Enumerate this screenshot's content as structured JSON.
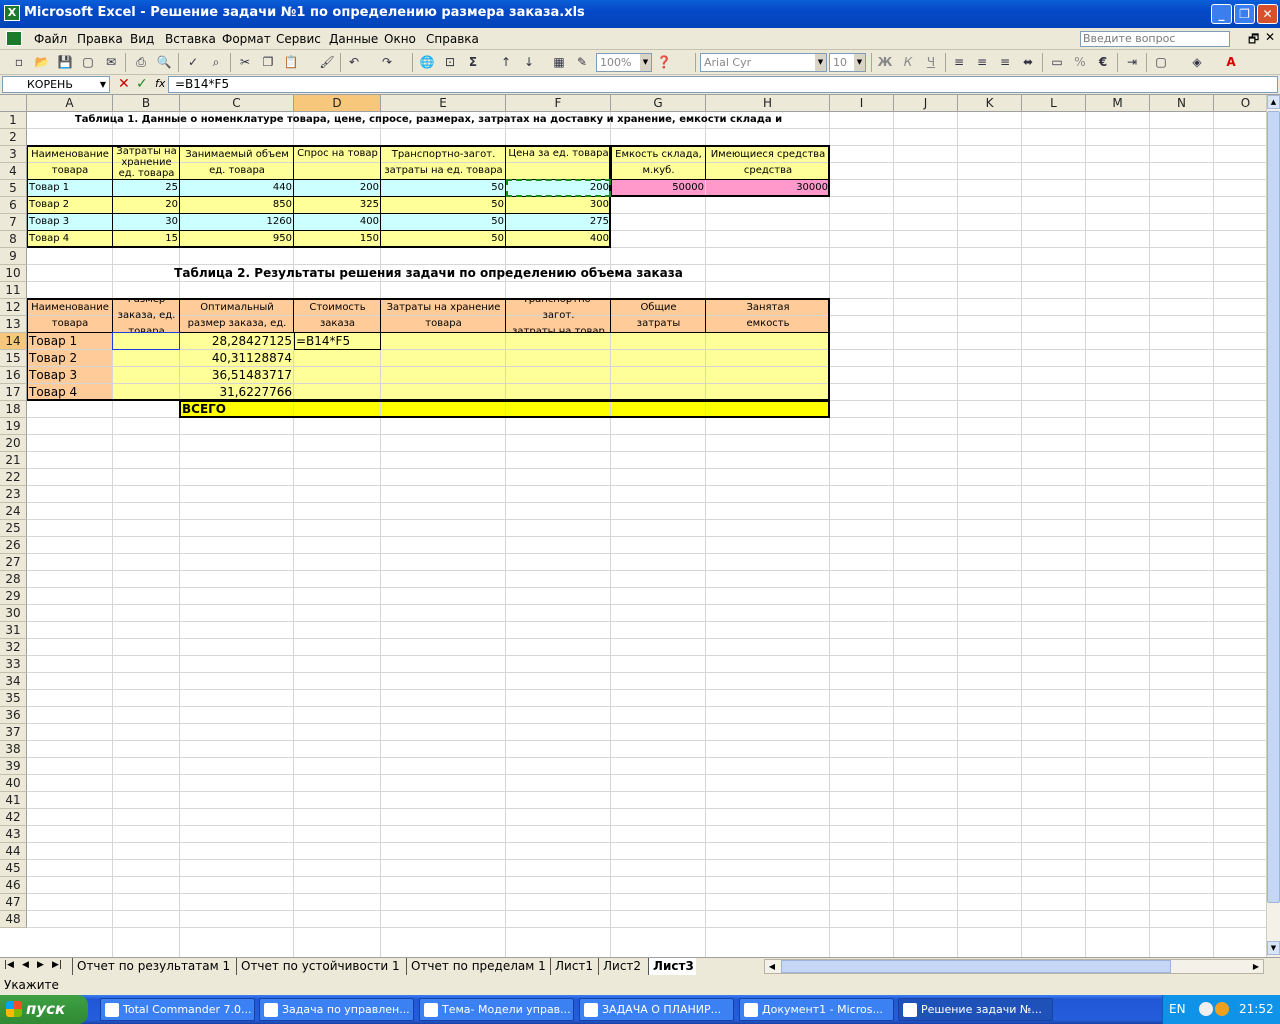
{
  "window": {
    "app_icon": "X",
    "title": "Microsoft Excel - Решение задачи №1 по определению размера заказа.xls"
  },
  "menu": {
    "items": [
      "Файл",
      "Правка",
      "Вид",
      "Вставка",
      "Формат",
      "Сервис",
      "Данные",
      "Окно",
      "Справка"
    ],
    "ask_placeholder": "Введите вопрос"
  },
  "toolbar": {
    "zoom": "100%",
    "font": "Arial Cyr",
    "size": "10",
    "bold": "Ж",
    "italic": "К",
    "underline": "Ч",
    "percent": "%",
    "euro": "€",
    "sigma": "Σ"
  },
  "formula": {
    "name_box": "КОРЕНЬ",
    "fx": "fx",
    "value": "=B14*F5"
  },
  "columns": [
    "A",
    "B",
    "C",
    "D",
    "E",
    "F",
    "G",
    "H",
    "I",
    "J",
    "K",
    "L",
    "M",
    "N",
    "O"
  ],
  "rows_visible": 48,
  "cells": [
    {
      "r": 1,
      "c": "A",
      "span": 8,
      "v": "Таблица 1. Данные о номенклатуре товара, цене, спросе, размерах, затратах на доставку и хранение, емкости склада и",
      "bold": true,
      "align": "center"
    },
    {
      "r": 3,
      "c": "A",
      "rs": 2,
      "v": "Наименование\nтовара",
      "align": "center"
    },
    {
      "r": 3,
      "c": "B",
      "rs": 2,
      "v": "Затраты на\nхранение\nед. товара",
      "align": "center"
    },
    {
      "r": 3,
      "c": "C",
      "rs": 2,
      "v": "Занимаемый объем\nед. товара",
      "align": "center"
    },
    {
      "r": 3,
      "c": "D",
      "rs": 2,
      "v": "Спрос на товар",
      "align": "center"
    },
    {
      "r": 3,
      "c": "E",
      "rs": 2,
      "v": "Транспортно-загот.\nзатраты на ед. товара",
      "align": "center"
    },
    {
      "r": 3,
      "c": "F",
      "rs": 2,
      "v": "Цена за ед. товара",
      "align": "center"
    },
    {
      "r": 3,
      "c": "G",
      "rs": 2,
      "v": "Емкость склада,\nм.куб.",
      "align": "center"
    },
    {
      "r": 3,
      "c": "H",
      "rs": 2,
      "v": "Имеющиеся средства\nсредства",
      "align": "center"
    },
    {
      "r": 5,
      "c": "A",
      "v": "Товар 1"
    },
    {
      "r": 5,
      "c": "B",
      "v": "25",
      "align": "right"
    },
    {
      "r": 5,
      "c": "C",
      "v": "440",
      "align": "right"
    },
    {
      "r": 5,
      "c": "D",
      "v": "200",
      "align": "right"
    },
    {
      "r": 5,
      "c": "E",
      "v": "50",
      "align": "right"
    },
    {
      "r": 5,
      "c": "F",
      "v": "200",
      "align": "right"
    },
    {
      "r": 5,
      "c": "G",
      "v": "50000",
      "align": "right"
    },
    {
      "r": 5,
      "c": "H",
      "v": "30000",
      "align": "right"
    },
    {
      "r": 6,
      "c": "A",
      "v": "Товар 2"
    },
    {
      "r": 6,
      "c": "B",
      "v": "20",
      "align": "right"
    },
    {
      "r": 6,
      "c": "C",
      "v": "850",
      "align": "right"
    },
    {
      "r": 6,
      "c": "D",
      "v": "325",
      "align": "right"
    },
    {
      "r": 6,
      "c": "E",
      "v": "50",
      "align": "right"
    },
    {
      "r": 6,
      "c": "F",
      "v": "300",
      "align": "right"
    },
    {
      "r": 7,
      "c": "A",
      "v": "Товар 3"
    },
    {
      "r": 7,
      "c": "B",
      "v": "30",
      "align": "right"
    },
    {
      "r": 7,
      "c": "C",
      "v": "1260",
      "align": "right"
    },
    {
      "r": 7,
      "c": "D",
      "v": "400",
      "align": "right"
    },
    {
      "r": 7,
      "c": "E",
      "v": "50",
      "align": "right"
    },
    {
      "r": 7,
      "c": "F",
      "v": "275",
      "align": "right"
    },
    {
      "r": 8,
      "c": "A",
      "v": "Товар 4"
    },
    {
      "r": 8,
      "c": "B",
      "v": "15",
      "align": "right"
    },
    {
      "r": 8,
      "c": "C",
      "v": "950",
      "align": "right"
    },
    {
      "r": 8,
      "c": "D",
      "v": "150",
      "align": "right"
    },
    {
      "r": 8,
      "c": "E",
      "v": "50",
      "align": "right"
    },
    {
      "r": 8,
      "c": "F",
      "v": "400",
      "align": "right"
    },
    {
      "r": 10,
      "c": "A",
      "span": 8,
      "v": "Таблица 2. Результаты решения задачи по определению объема заказа",
      "bold": true,
      "align": "center",
      "size": 13
    },
    {
      "r": 12,
      "c": "A",
      "rs": 2,
      "v": "Наименование\nтовара",
      "align": "center"
    },
    {
      "r": 12,
      "c": "B",
      "rs": 2,
      "v": "Размер\nзаказа, ед. товара",
      "align": "center"
    },
    {
      "r": 12,
      "c": "C",
      "rs": 2,
      "v": "Оптимальный\nразмер заказа, ед.",
      "align": "center"
    },
    {
      "r": 12,
      "c": "D",
      "rs": 2,
      "v": "Стоимость\nзаказа",
      "align": "center"
    },
    {
      "r": 12,
      "c": "E",
      "rs": 2,
      "v": "Затраты на хранение\nтовара",
      "align": "center"
    },
    {
      "r": 12,
      "c": "F",
      "rs": 2,
      "v": "Транспортно-загот.\nзатраты на товар",
      "align": "center"
    },
    {
      "r": 12,
      "c": "G",
      "rs": 2,
      "v": "Общие\nзатраты",
      "align": "center"
    },
    {
      "r": 12,
      "c": "H",
      "rs": 2,
      "v": "Занятая\nемкость",
      "align": "center"
    },
    {
      "r": 14,
      "c": "A",
      "v": "Товар 1",
      "size": 13
    },
    {
      "r": 14,
      "c": "C",
      "v": "28,28427125",
      "align": "right",
      "size": 13
    },
    {
      "r": 14,
      "c": "D",
      "v": "=B14*F5",
      "size": 13
    },
    {
      "r": 15,
      "c": "A",
      "v": "Товар 2",
      "size": 13
    },
    {
      "r": 15,
      "c": "C",
      "v": "40,31128874",
      "align": "right",
      "size": 13
    },
    {
      "r": 16,
      "c": "A",
      "v": "Товар 3",
      "size": 13
    },
    {
      "r": 16,
      "c": "C",
      "v": "36,51483717",
      "align": "right",
      "size": 13
    },
    {
      "r": 17,
      "c": "A",
      "v": "Товар 4",
      "size": 13
    },
    {
      "r": 17,
      "c": "C",
      "v": "31,6227766",
      "align": "right",
      "size": 13
    },
    {
      "r": 18,
      "c": "C",
      "v": "ВСЕГО",
      "bold": true,
      "size": 13
    }
  ],
  "sheets": {
    "tabs": [
      "Отчет по результатам 1",
      "Отчет по устойчивости 1",
      "Отчет по пределам 1",
      "Лист1",
      "Лист2",
      "Лист3"
    ],
    "active": "Лист3"
  },
  "status": {
    "mode": "Укажите"
  },
  "taskbar": {
    "start": "пуск",
    "tasks": [
      "Total Commander 7.0...",
      "Задача по управлен...",
      "Тема- Модели управ...",
      "ЗАДАЧА О ПЛАНИР...",
      "Документ1 - Micros...",
      "Решение задачи №..."
    ],
    "active_task": 5,
    "lang": "EN",
    "clock": "21:52"
  },
  "colors": {
    "cyan": "#ccffff",
    "yellow": "#ffff99",
    "pink": "#ff99cc",
    "orange": "#ffcc99",
    "bright_yellow": "#ffff00",
    "accent": "#0a5fd8"
  }
}
